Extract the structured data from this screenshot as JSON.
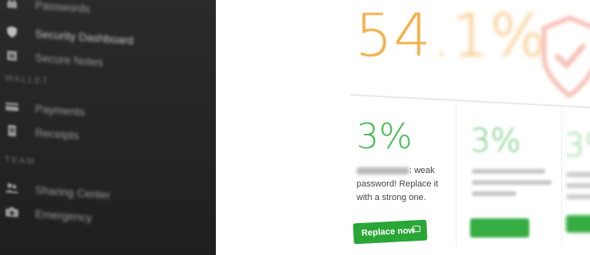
{
  "sidebar": {
    "items": [
      {
        "label": "Passwords",
        "icon": "lock-icon"
      },
      {
        "label": "Security Dashboard",
        "icon": "shield-icon",
        "active": true
      },
      {
        "label": "Secure Notes",
        "icon": "note-icon"
      }
    ],
    "wallet_heading": "WALLET",
    "wallet_items": [
      {
        "label": "Payments",
        "icon": "card-icon"
      },
      {
        "label": "Receipts",
        "icon": "receipt-icon"
      }
    ],
    "team_heading": "TEAM",
    "team_items": [
      {
        "label": "Sharing Center",
        "icon": "users-icon"
      },
      {
        "label": "Emergency",
        "icon": "emergency-icon"
      }
    ]
  },
  "main": {
    "security_score": {
      "main": "54",
      "tail": ".1%",
      "color": "#f2ad45"
    },
    "cards": [
      {
        "percent": "3%",
        "text_after_site": ": weak password! Replace it with a strong one.",
        "button_label": "Replace now"
      },
      {
        "percent": "3%"
      },
      {
        "percent": "3%"
      }
    ]
  },
  "colors": {
    "sidebar_bg": "#242424",
    "accent_green": "#2aa637",
    "score_orange": "#f2ad45",
    "shield_red": "#f08c78"
  }
}
